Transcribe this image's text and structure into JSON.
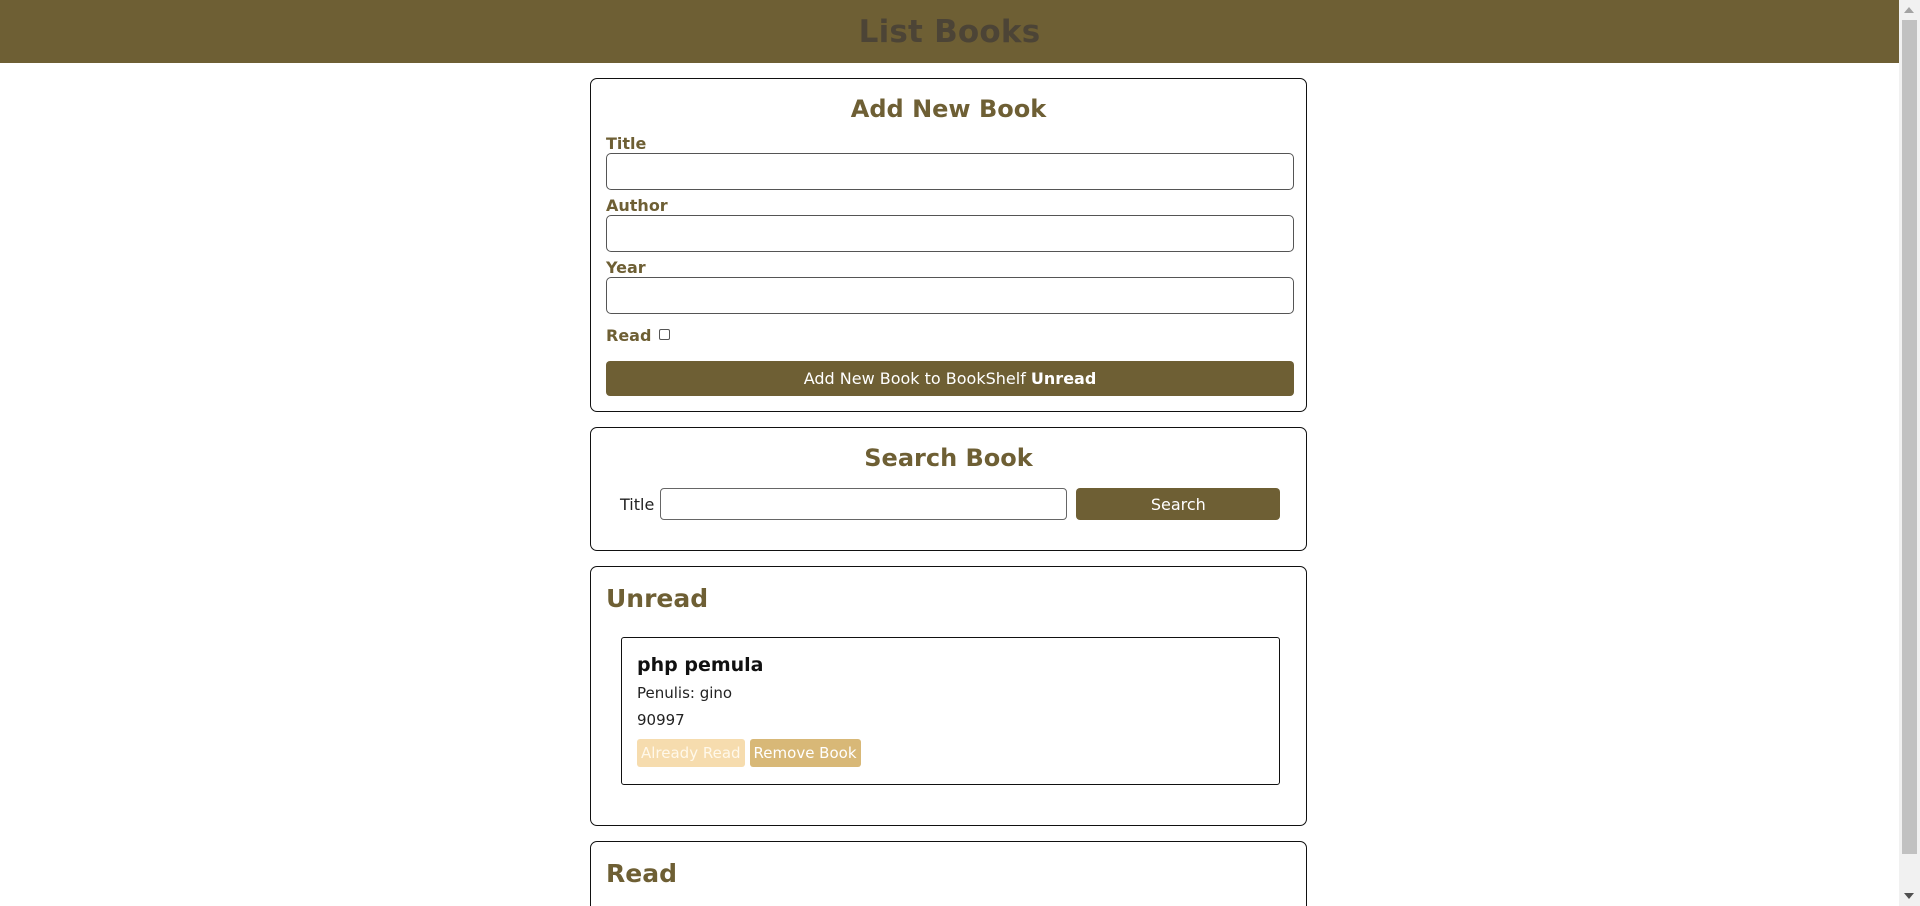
{
  "header": {
    "title": "List Books"
  },
  "add_form": {
    "heading": "Add New Book",
    "title_label": "Title",
    "title_value": "",
    "author_label": "Author",
    "author_value": "",
    "year_label": "Year",
    "year_value": "",
    "read_label": "Read",
    "read_checked": false,
    "submit_prefix": "Add New Book to BookShelf ",
    "submit_shelf": "Unread"
  },
  "search": {
    "heading": "Search Book",
    "title_label": "Title",
    "query_value": "",
    "button_label": "Search"
  },
  "unread_shelf": {
    "heading": "Unread",
    "books": [
      {
        "title": "php pemula",
        "author_line": "Penulis: gino",
        "year": "90997",
        "already_read_label": "Already Read",
        "remove_label": "Remove Book"
      }
    ]
  },
  "read_shelf": {
    "heading": "Read"
  },
  "colors": {
    "brand": "#6e5f34",
    "header_text": "#4c4436",
    "already_read_bg": "#f6dcae",
    "remove_bg": "#d8b877"
  }
}
